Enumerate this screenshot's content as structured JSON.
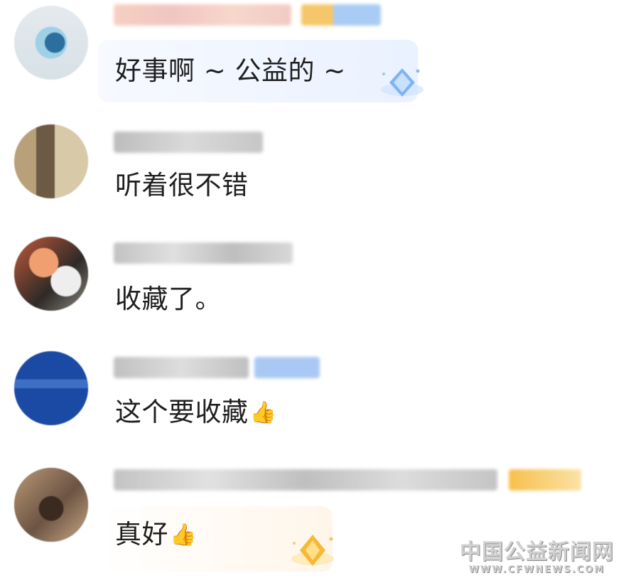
{
  "comments": [
    {
      "text": "好事啊 ~ 公益的 ~"
    },
    {
      "text": "听着很不错"
    },
    {
      "text": "收藏了。"
    },
    {
      "text": "这个要收藏",
      "emoji": "👍"
    },
    {
      "text": "真好",
      "emoji": "👍"
    }
  ],
  "watermark": {
    "name": "中国公益新闻网",
    "url": "WWW.CFWNEWS.COM"
  },
  "icons": {
    "avatar": "blurred-avatar",
    "like": "thumbs-up-emoji",
    "decoration": "diamond-gem-icon"
  },
  "colors": {
    "bubble_tint": "#eef4ff",
    "bubble_gold_tint": "#fff8ec",
    "vip_blue": "#7fb2f4",
    "vip_gold": "#f7c14a"
  }
}
